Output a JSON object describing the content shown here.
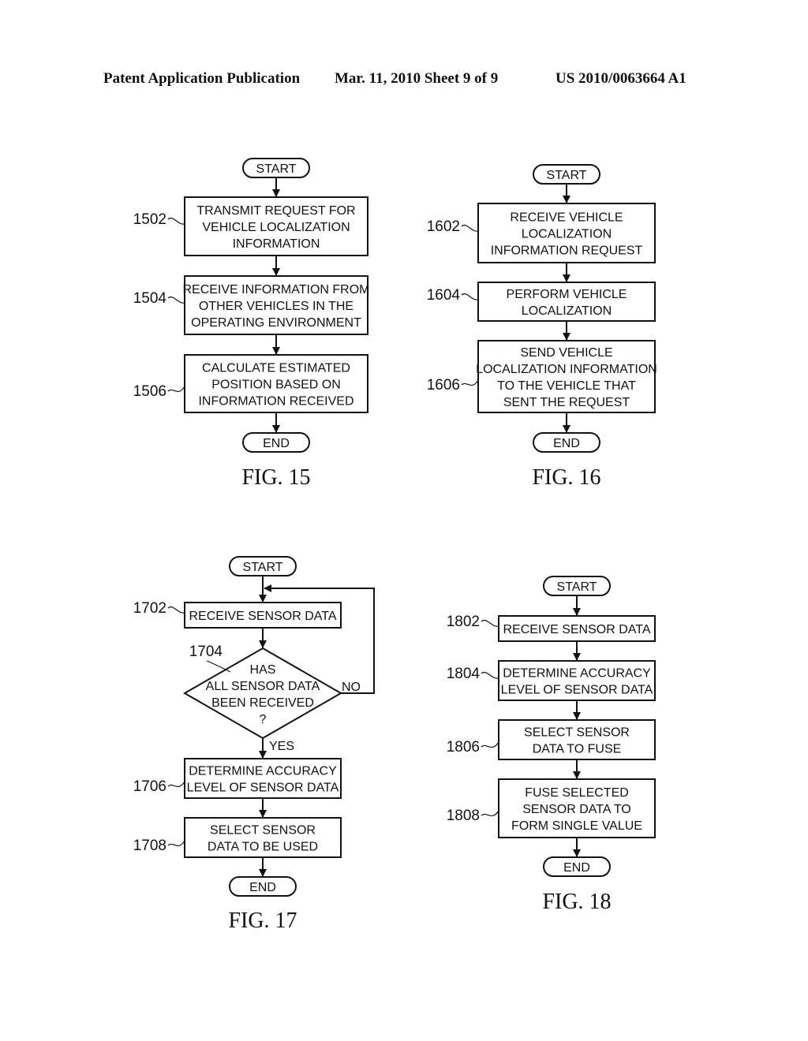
{
  "header": {
    "left": "Patent Application Publication",
    "center": "Mar. 11, 2010  Sheet 9 of 9",
    "right": "US 2010/0063664 A1"
  },
  "figures": [
    {
      "id": "fig15",
      "caption": "FIG. 15",
      "start_label": "START",
      "end_label": "END",
      "steps": [
        {
          "ref": "1502",
          "lines": [
            "TRANSMIT REQUEST FOR",
            "VEHICLE LOCALIZATION",
            "INFORMATION"
          ]
        },
        {
          "ref": "1504",
          "lines": [
            "RECEIVE INFORMATION FROM",
            "OTHER VEHICLES IN THE",
            "OPERATING ENVIRONMENT"
          ]
        },
        {
          "ref": "1506",
          "lines": [
            "CALCULATE ESTIMATED",
            "POSITION BASED ON",
            "INFORMATION RECEIVED"
          ]
        }
      ]
    },
    {
      "id": "fig16",
      "caption": "FIG. 16",
      "start_label": "START",
      "end_label": "END",
      "steps": [
        {
          "ref": "1602",
          "lines": [
            "RECEIVE VEHICLE",
            "LOCALIZATION",
            "INFORMATION REQUEST"
          ]
        },
        {
          "ref": "1604",
          "lines": [
            "PERFORM VEHICLE",
            "LOCALIZATION"
          ]
        },
        {
          "ref": "1606",
          "lines": [
            "SEND VEHICLE",
            "LOCALIZATION INFORMATION",
            "TO THE VEHICLE THAT",
            "SENT THE REQUEST"
          ]
        }
      ]
    },
    {
      "id": "fig17",
      "caption": "FIG. 17",
      "start_label": "START",
      "end_label": "END",
      "steps": [
        {
          "ref": "1702",
          "lines": [
            "RECEIVE SENSOR DATA"
          ]
        },
        {
          "ref": "1704",
          "type": "decision",
          "lines": [
            "HAS",
            "ALL SENSOR DATA",
            "BEEN RECEIVED",
            "?"
          ],
          "yes_label": "YES",
          "no_label": "NO"
        },
        {
          "ref": "1706",
          "lines": [
            "DETERMINE ACCURACY",
            "LEVEL OF SENSOR DATA"
          ]
        },
        {
          "ref": "1708",
          "lines": [
            "SELECT SENSOR",
            "DATA TO BE USED"
          ]
        }
      ]
    },
    {
      "id": "fig18",
      "caption": "FIG. 18",
      "start_label": "START",
      "end_label": "END",
      "steps": [
        {
          "ref": "1802",
          "lines": [
            "RECEIVE SENSOR DATA"
          ]
        },
        {
          "ref": "1804",
          "lines": [
            "DETERMINE ACCURACY",
            "LEVEL OF SENSOR DATA"
          ]
        },
        {
          "ref": "1806",
          "lines": [
            "SELECT SENSOR",
            "DATA TO FUSE"
          ]
        },
        {
          "ref": "1808",
          "lines": [
            "FUSE SELECTED",
            "SENSOR DATA TO",
            "FORM SINGLE VALUE"
          ]
        }
      ]
    }
  ]
}
